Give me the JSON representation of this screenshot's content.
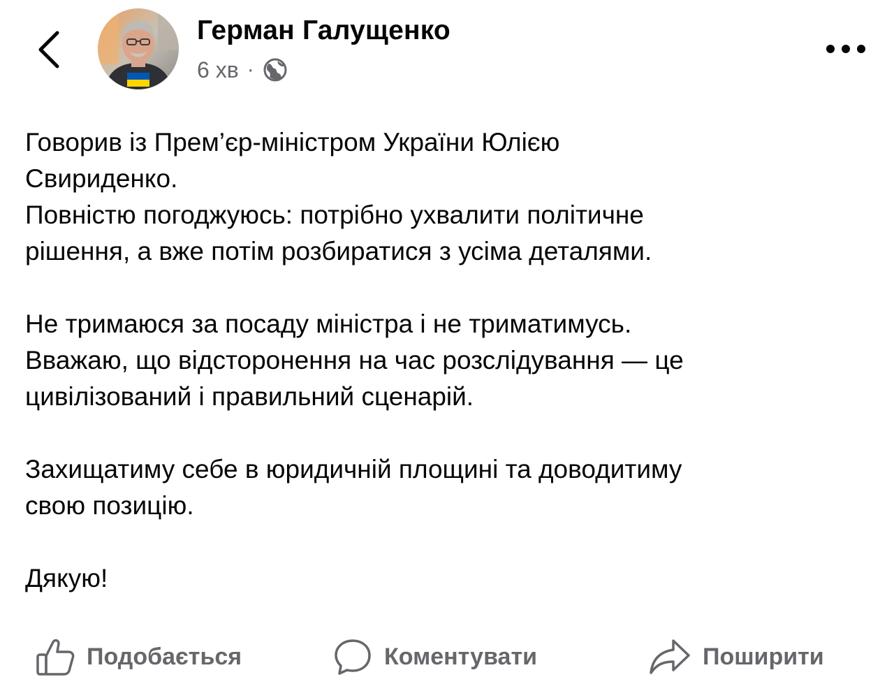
{
  "header": {
    "back_icon": "chevron-left-icon",
    "author_name": "Герман Галущенко",
    "time_ago": "6 хв",
    "separator": "·",
    "privacy_icon": "globe-icon",
    "more_icon": "more-horizontal-icon"
  },
  "post": {
    "paragraphs": [
      "Говорив із Прем’єр-міністром України Юлією\nСвириденко.\nПовністю погоджуюсь: потрібно ухвалити політичне\nрішення, а вже потім розбиратися з усіма деталями.",
      "Не тримаюся за посаду міністра і не триматимусь.\nВважаю, що відсторонення на час розслідування — це\nцивілізований і правильний сценарій.",
      "Захищатиму себе в юридичній площині та доводитиму\nсвою позицію.",
      "Дякую!"
    ]
  },
  "actions": {
    "like_label": "Подобається",
    "comment_label": "Коментувати",
    "share_label": "Поширити"
  },
  "colors": {
    "text": "#050505",
    "secondary": "#65676b",
    "flag_blue": "#0057b7",
    "flag_yellow": "#ffd700"
  }
}
